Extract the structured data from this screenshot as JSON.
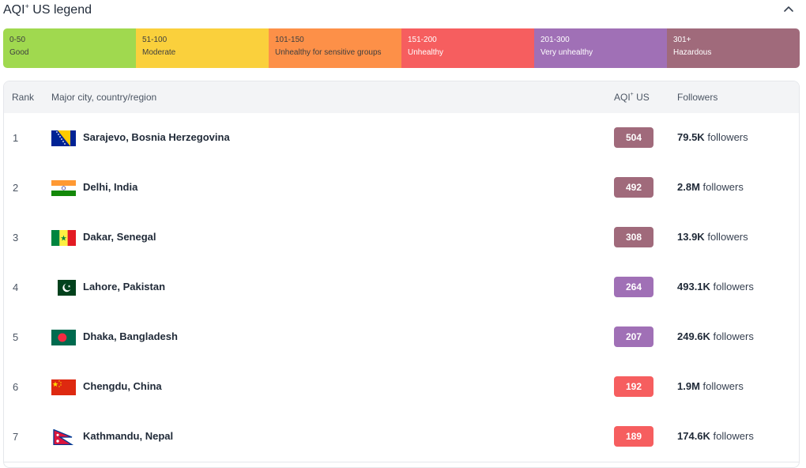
{
  "legend": {
    "title": "AQI",
    "title_sup": "+",
    "title_rest": " US legend",
    "segments": [
      {
        "range": "0-50",
        "label": "Good",
        "color": "#a0d94f",
        "text": "dark"
      },
      {
        "range": "51-100",
        "label": "Moderate",
        "color": "#fad03c",
        "text": "dark"
      },
      {
        "range": "101-150",
        "label": "Unhealthy for sensitive groups",
        "color": "#fd9048",
        "text": "dark"
      },
      {
        "range": "151-200",
        "label": "Unhealthy",
        "color": "#f65e5f",
        "text": "light"
      },
      {
        "range": "201-300",
        "label": "Very unhealthy",
        "color": "#a070b6",
        "text": "light"
      },
      {
        "range": "301+",
        "label": "Hazardous",
        "color": "#a06a7b",
        "text": "light"
      }
    ]
  },
  "table": {
    "headers": {
      "rank": "Rank",
      "city": "Major city, country/region",
      "aqi_main": "AQI",
      "aqi_sup": "+",
      "aqi_rest": " US",
      "followers": "Followers"
    },
    "rows": [
      {
        "rank": "1",
        "city": "Sarajevo, Bosnia Herzegovina",
        "flag": "bosnia-flag-icon",
        "aqi": "504",
        "aqi_color": "#a06a7b",
        "followers_num": "79.5K",
        "followers_label": "followers"
      },
      {
        "rank": "2",
        "city": "Delhi, India",
        "flag": "india-flag-icon",
        "aqi": "492",
        "aqi_color": "#a06a7b",
        "followers_num": "2.8M",
        "followers_label": "followers"
      },
      {
        "rank": "3",
        "city": "Dakar, Senegal",
        "flag": "senegal-flag-icon",
        "aqi": "308",
        "aqi_color": "#a06a7b",
        "followers_num": "13.9K",
        "followers_label": "followers"
      },
      {
        "rank": "4",
        "city": "Lahore, Pakistan",
        "flag": "pakistan-flag-icon",
        "aqi": "264",
        "aqi_color": "#a070b6",
        "followers_num": "493.1K",
        "followers_label": "followers"
      },
      {
        "rank": "5",
        "city": "Dhaka, Bangladesh",
        "flag": "bangladesh-flag-icon",
        "aqi": "207",
        "aqi_color": "#a070b6",
        "followers_num": "249.6K",
        "followers_label": "followers"
      },
      {
        "rank": "6",
        "city": "Chengdu, China",
        "flag": "china-flag-icon",
        "aqi": "192",
        "aqi_color": "#f65e5f",
        "followers_num": "1.9M",
        "followers_label": "followers"
      },
      {
        "rank": "7",
        "city": "Kathmandu, Nepal",
        "flag": "nepal-flag-icon",
        "aqi": "189",
        "aqi_color": "#f65e5f",
        "followers_num": "174.6K",
        "followers_label": "followers"
      }
    ]
  }
}
